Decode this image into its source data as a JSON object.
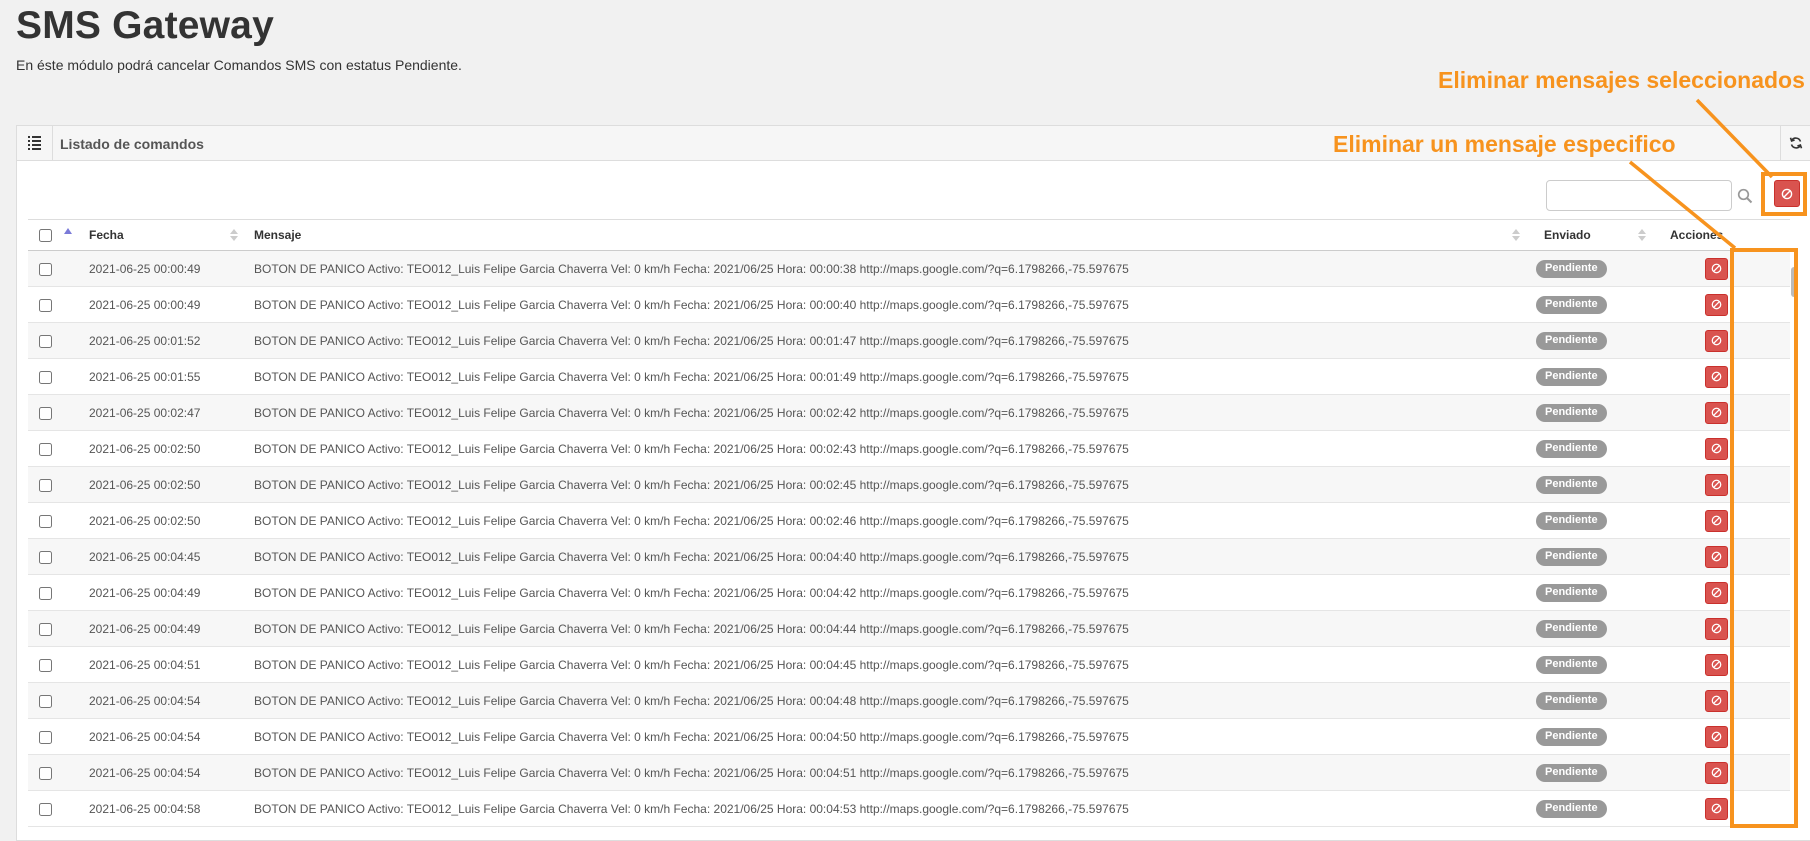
{
  "page": {
    "title": "SMS Gateway",
    "subtitle": "En éste módulo podrá cancelar Comandos SMS con estatus Pendiente."
  },
  "panel": {
    "title": "Listado de comandos",
    "icon": "list-icon",
    "refresh_icon": "refresh-icon"
  },
  "search": {
    "value": "",
    "placeholder": "",
    "icon": "search-icon"
  },
  "toolbar": {
    "delete_selected_icon": "cancel-icon"
  },
  "table": {
    "columns": [
      "Fecha",
      "Mensaje",
      "Enviado",
      "Acciones"
    ],
    "rows": [
      {
        "fecha": "2021-06-25 00:00:49",
        "mensaje": "BOTON DE PANICO Activo: TEO012_Luis Felipe Garcia Chaverra Vel: 0 km/h Fecha: 2021/06/25 Hora: 00:00:38 http://maps.google.com/?q=6.1798266,-75.597675",
        "estado": "Pendiente"
      },
      {
        "fecha": "2021-06-25 00:00:49",
        "mensaje": "BOTON DE PANICO Activo: TEO012_Luis Felipe Garcia Chaverra Vel: 0 km/h Fecha: 2021/06/25 Hora: 00:00:40 http://maps.google.com/?q=6.1798266,-75.597675",
        "estado": "Pendiente"
      },
      {
        "fecha": "2021-06-25 00:01:52",
        "mensaje": "BOTON DE PANICO Activo: TEO012_Luis Felipe Garcia Chaverra Vel: 0 km/h Fecha: 2021/06/25 Hora: 00:01:47 http://maps.google.com/?q=6.1798266,-75.597675",
        "estado": "Pendiente"
      },
      {
        "fecha": "2021-06-25 00:01:55",
        "mensaje": "BOTON DE PANICO Activo: TEO012_Luis Felipe Garcia Chaverra Vel: 0 km/h Fecha: 2021/06/25 Hora: 00:01:49 http://maps.google.com/?q=6.1798266,-75.597675",
        "estado": "Pendiente"
      },
      {
        "fecha": "2021-06-25 00:02:47",
        "mensaje": "BOTON DE PANICO Activo: TEO012_Luis Felipe Garcia Chaverra Vel: 0 km/h Fecha: 2021/06/25 Hora: 00:02:42 http://maps.google.com/?q=6.1798266,-75.597675",
        "estado": "Pendiente"
      },
      {
        "fecha": "2021-06-25 00:02:50",
        "mensaje": "BOTON DE PANICO Activo: TEO012_Luis Felipe Garcia Chaverra Vel: 0 km/h Fecha: 2021/06/25 Hora: 00:02:43 http://maps.google.com/?q=6.1798266,-75.597675",
        "estado": "Pendiente"
      },
      {
        "fecha": "2021-06-25 00:02:50",
        "mensaje": "BOTON DE PANICO Activo: TEO012_Luis Felipe Garcia Chaverra Vel: 0 km/h Fecha: 2021/06/25 Hora: 00:02:45 http://maps.google.com/?q=6.1798266,-75.597675",
        "estado": "Pendiente"
      },
      {
        "fecha": "2021-06-25 00:02:50",
        "mensaje": "BOTON DE PANICO Activo: TEO012_Luis Felipe Garcia Chaverra Vel: 0 km/h Fecha: 2021/06/25 Hora: 00:02:46 http://maps.google.com/?q=6.1798266,-75.597675",
        "estado": "Pendiente"
      },
      {
        "fecha": "2021-06-25 00:04:45",
        "mensaje": "BOTON DE PANICO Activo: TEO012_Luis Felipe Garcia Chaverra Vel: 0 km/h Fecha: 2021/06/25 Hora: 00:04:40 http://maps.google.com/?q=6.1798266,-75.597675",
        "estado": "Pendiente"
      },
      {
        "fecha": "2021-06-25 00:04:49",
        "mensaje": "BOTON DE PANICO Activo: TEO012_Luis Felipe Garcia Chaverra Vel: 0 km/h Fecha: 2021/06/25 Hora: 00:04:42 http://maps.google.com/?q=6.1798266,-75.597675",
        "estado": "Pendiente"
      },
      {
        "fecha": "2021-06-25 00:04:49",
        "mensaje": "BOTON DE PANICO Activo: TEO012_Luis Felipe Garcia Chaverra Vel: 0 km/h Fecha: 2021/06/25 Hora: 00:04:44 http://maps.google.com/?q=6.1798266,-75.597675",
        "estado": "Pendiente"
      },
      {
        "fecha": "2021-06-25 00:04:51",
        "mensaje": "BOTON DE PANICO Activo: TEO012_Luis Felipe Garcia Chaverra Vel: 0 km/h Fecha: 2021/06/25 Hora: 00:04:45 http://maps.google.com/?q=6.1798266,-75.597675",
        "estado": "Pendiente"
      },
      {
        "fecha": "2021-06-25 00:04:54",
        "mensaje": "BOTON DE PANICO Activo: TEO012_Luis Felipe Garcia Chaverra Vel: 0 km/h Fecha: 2021/06/25 Hora: 00:04:48 http://maps.google.com/?q=6.1798266,-75.597675",
        "estado": "Pendiente"
      },
      {
        "fecha": "2021-06-25 00:04:54",
        "mensaje": "BOTON DE PANICO Activo: TEO012_Luis Felipe Garcia Chaverra Vel: 0 km/h Fecha: 2021/06/25 Hora: 00:04:50 http://maps.google.com/?q=6.1798266,-75.597675",
        "estado": "Pendiente"
      },
      {
        "fecha": "2021-06-25 00:04:54",
        "mensaje": "BOTON DE PANICO Activo: TEO012_Luis Felipe Garcia Chaverra Vel: 0 km/h Fecha: 2021/06/25 Hora: 00:04:51 http://maps.google.com/?q=6.1798266,-75.597675",
        "estado": "Pendiente"
      },
      {
        "fecha": "2021-06-25 00:04:58",
        "mensaje": "BOTON DE PANICO Activo: TEO012_Luis Felipe Garcia Chaverra Vel: 0 km/h Fecha: 2021/06/25 Hora: 00:04:53 http://maps.google.com/?q=6.1798266,-75.597675",
        "estado": "Pendiente"
      }
    ],
    "row_action_icon": "cancel-icon"
  },
  "annotations": {
    "delete_selected_label": "Eliminar mensajes seleccionados",
    "delete_one_label": "Eliminar un mensaje especifico"
  },
  "colors": {
    "danger": "#d9534f",
    "badge": "#999999",
    "annotation": "#f7931e"
  }
}
